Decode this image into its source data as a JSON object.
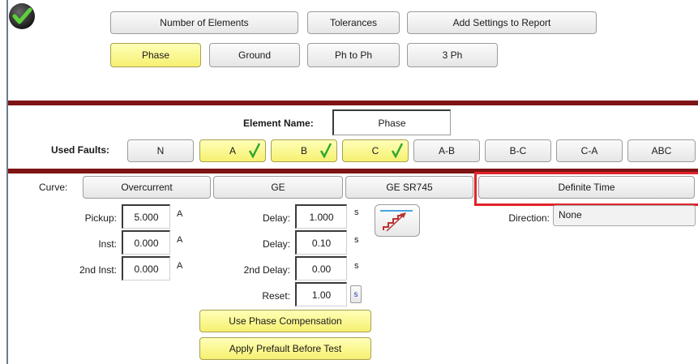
{
  "top_buttons": {
    "number_of_elements": "Number of Elements",
    "tolerances": "Tolerances",
    "add_settings_to_report": "Add Settings to Report"
  },
  "element_tabs": [
    "Phase",
    "Ground",
    "Ph to Ph",
    "3 Ph"
  ],
  "element_name": {
    "label": "Element Name:",
    "value": "Phase"
  },
  "used_faults": {
    "label": "Used Faults:",
    "buttons": [
      "N",
      "A",
      "B",
      "C",
      "A-B",
      "B-C",
      "C-A",
      "ABC"
    ]
  },
  "curve": {
    "label": "Curve:",
    "options": [
      "Overcurrent",
      "GE",
      "GE SR745",
      "Definite Time"
    ]
  },
  "settings": {
    "pickup": {
      "label": "Pickup:",
      "value": "5.000",
      "unit": "A"
    },
    "inst": {
      "label": "Inst:",
      "value": "0.000",
      "unit": "A"
    },
    "inst2": {
      "label": "2nd Inst:",
      "value": "0.000",
      "unit": "A"
    },
    "delay": {
      "label": "Delay:",
      "value": "1.000",
      "unit": "s"
    },
    "inst_delay": {
      "label": "Delay:",
      "value": "0.10",
      "unit": "s"
    },
    "delay2": {
      "label": "2nd Delay:",
      "value": "0.00",
      "unit": "s"
    },
    "reset": {
      "label": "Reset:",
      "value": "1.00",
      "unit": "s"
    }
  },
  "direction": {
    "label": "Direction:",
    "value": "None"
  },
  "actions": {
    "use_phase_compensation": "Use Phase Compensation",
    "apply_prefault": "Apply Prefault Before Test"
  },
  "colors": {
    "active_yellow": "#f6f070",
    "dark_red_bar": "#7e1414",
    "highlight_red": "#e0242a",
    "check_green": "#2ea82e"
  },
  "icons": [
    "status-check-icon",
    "checkmark-icon",
    "staircase-curve-icon"
  ]
}
